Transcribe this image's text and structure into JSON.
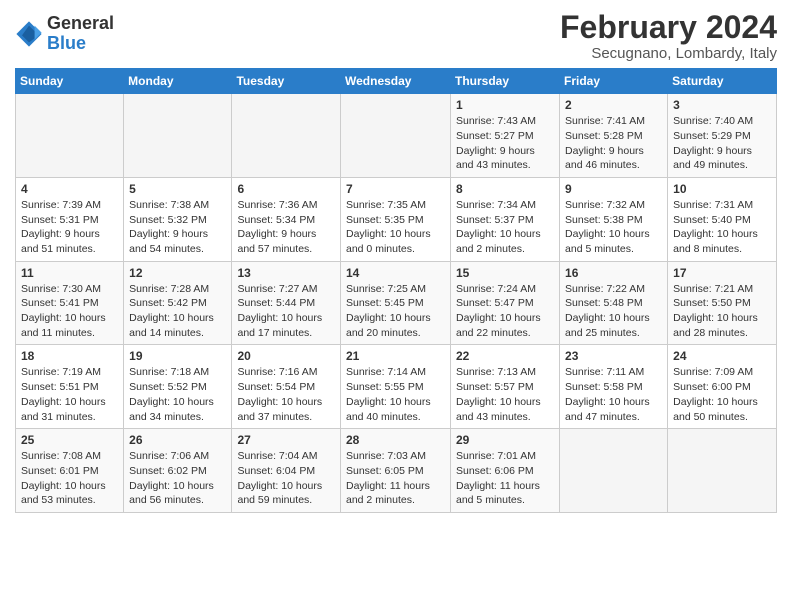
{
  "header": {
    "logo_line1": "General",
    "logo_line2": "Blue",
    "title": "February 2024",
    "subtitle": "Secugnano, Lombardy, Italy"
  },
  "weekdays": [
    "Sunday",
    "Monday",
    "Tuesday",
    "Wednesday",
    "Thursday",
    "Friday",
    "Saturday"
  ],
  "weeks": [
    [
      {
        "num": "",
        "info": ""
      },
      {
        "num": "",
        "info": ""
      },
      {
        "num": "",
        "info": ""
      },
      {
        "num": "",
        "info": ""
      },
      {
        "num": "1",
        "info": "Sunrise: 7:43 AM\nSunset: 5:27 PM\nDaylight: 9 hours\nand 43 minutes."
      },
      {
        "num": "2",
        "info": "Sunrise: 7:41 AM\nSunset: 5:28 PM\nDaylight: 9 hours\nand 46 minutes."
      },
      {
        "num": "3",
        "info": "Sunrise: 7:40 AM\nSunset: 5:29 PM\nDaylight: 9 hours\nand 49 minutes."
      }
    ],
    [
      {
        "num": "4",
        "info": "Sunrise: 7:39 AM\nSunset: 5:31 PM\nDaylight: 9 hours\nand 51 minutes."
      },
      {
        "num": "5",
        "info": "Sunrise: 7:38 AM\nSunset: 5:32 PM\nDaylight: 9 hours\nand 54 minutes."
      },
      {
        "num": "6",
        "info": "Sunrise: 7:36 AM\nSunset: 5:34 PM\nDaylight: 9 hours\nand 57 minutes."
      },
      {
        "num": "7",
        "info": "Sunrise: 7:35 AM\nSunset: 5:35 PM\nDaylight: 10 hours\nand 0 minutes."
      },
      {
        "num": "8",
        "info": "Sunrise: 7:34 AM\nSunset: 5:37 PM\nDaylight: 10 hours\nand 2 minutes."
      },
      {
        "num": "9",
        "info": "Sunrise: 7:32 AM\nSunset: 5:38 PM\nDaylight: 10 hours\nand 5 minutes."
      },
      {
        "num": "10",
        "info": "Sunrise: 7:31 AM\nSunset: 5:40 PM\nDaylight: 10 hours\nand 8 minutes."
      }
    ],
    [
      {
        "num": "11",
        "info": "Sunrise: 7:30 AM\nSunset: 5:41 PM\nDaylight: 10 hours\nand 11 minutes."
      },
      {
        "num": "12",
        "info": "Sunrise: 7:28 AM\nSunset: 5:42 PM\nDaylight: 10 hours\nand 14 minutes."
      },
      {
        "num": "13",
        "info": "Sunrise: 7:27 AM\nSunset: 5:44 PM\nDaylight: 10 hours\nand 17 minutes."
      },
      {
        "num": "14",
        "info": "Sunrise: 7:25 AM\nSunset: 5:45 PM\nDaylight: 10 hours\nand 20 minutes."
      },
      {
        "num": "15",
        "info": "Sunrise: 7:24 AM\nSunset: 5:47 PM\nDaylight: 10 hours\nand 22 minutes."
      },
      {
        "num": "16",
        "info": "Sunrise: 7:22 AM\nSunset: 5:48 PM\nDaylight: 10 hours\nand 25 minutes."
      },
      {
        "num": "17",
        "info": "Sunrise: 7:21 AM\nSunset: 5:50 PM\nDaylight: 10 hours\nand 28 minutes."
      }
    ],
    [
      {
        "num": "18",
        "info": "Sunrise: 7:19 AM\nSunset: 5:51 PM\nDaylight: 10 hours\nand 31 minutes."
      },
      {
        "num": "19",
        "info": "Sunrise: 7:18 AM\nSunset: 5:52 PM\nDaylight: 10 hours\nand 34 minutes."
      },
      {
        "num": "20",
        "info": "Sunrise: 7:16 AM\nSunset: 5:54 PM\nDaylight: 10 hours\nand 37 minutes."
      },
      {
        "num": "21",
        "info": "Sunrise: 7:14 AM\nSunset: 5:55 PM\nDaylight: 10 hours\nand 40 minutes."
      },
      {
        "num": "22",
        "info": "Sunrise: 7:13 AM\nSunset: 5:57 PM\nDaylight: 10 hours\nand 43 minutes."
      },
      {
        "num": "23",
        "info": "Sunrise: 7:11 AM\nSunset: 5:58 PM\nDaylight: 10 hours\nand 47 minutes."
      },
      {
        "num": "24",
        "info": "Sunrise: 7:09 AM\nSunset: 6:00 PM\nDaylight: 10 hours\nand 50 minutes."
      }
    ],
    [
      {
        "num": "25",
        "info": "Sunrise: 7:08 AM\nSunset: 6:01 PM\nDaylight: 10 hours\nand 53 minutes."
      },
      {
        "num": "26",
        "info": "Sunrise: 7:06 AM\nSunset: 6:02 PM\nDaylight: 10 hours\nand 56 minutes."
      },
      {
        "num": "27",
        "info": "Sunrise: 7:04 AM\nSunset: 6:04 PM\nDaylight: 10 hours\nand 59 minutes."
      },
      {
        "num": "28",
        "info": "Sunrise: 7:03 AM\nSunset: 6:05 PM\nDaylight: 11 hours\nand 2 minutes."
      },
      {
        "num": "29",
        "info": "Sunrise: 7:01 AM\nSunset: 6:06 PM\nDaylight: 11 hours\nand 5 minutes."
      },
      {
        "num": "",
        "info": ""
      },
      {
        "num": "",
        "info": ""
      }
    ]
  ]
}
